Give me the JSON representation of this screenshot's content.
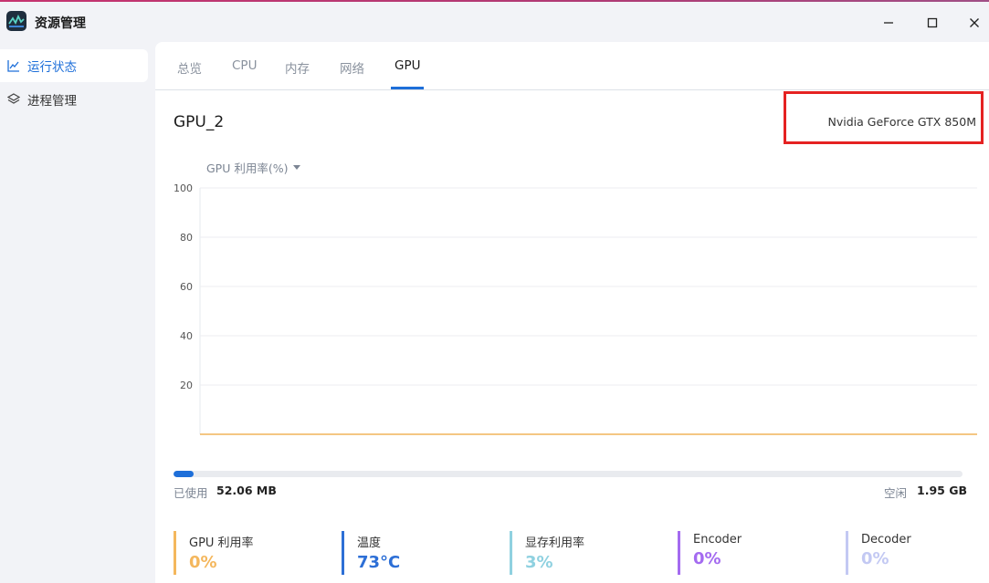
{
  "window": {
    "title": "资源管理",
    "accent": "#1e6fd9"
  },
  "sidebar": {
    "items": [
      {
        "label": "运行状态",
        "icon": "line-chart-icon",
        "active": true
      },
      {
        "label": "进程管理",
        "icon": "layers-icon",
        "active": false
      }
    ]
  },
  "tabs": [
    {
      "label": "总览"
    },
    {
      "label": "CPU"
    },
    {
      "label": "内存"
    },
    {
      "label": "网络"
    },
    {
      "label": "GPU",
      "active": true
    }
  ],
  "gpu": {
    "name": "GPU_2",
    "model": "Nvidia GeForce GTX 850M",
    "metric_select": "GPU 利用率(%)"
  },
  "chart_data": {
    "type": "line",
    "ylim": [
      0,
      100
    ],
    "yticks": [
      "100",
      "80",
      "60",
      "40",
      "20"
    ],
    "grid": true,
    "series": [
      {
        "values": [
          0,
          0,
          0,
          0,
          0,
          0,
          0,
          0,
          0,
          0,
          0,
          0,
          0,
          0,
          0,
          0,
          0,
          0,
          0,
          0,
          0,
          0,
          0,
          0,
          0,
          0,
          0,
          0,
          0,
          0
        ],
        "color": "#f0b35a"
      }
    ]
  },
  "memory": {
    "used_label": "已使用",
    "used_value": "52.06 MB",
    "free_label": "空闲",
    "free_value": "1.95 GB",
    "used_fraction": 0.026
  },
  "stats": [
    {
      "label": "GPU 利用率",
      "value": "0%",
      "color": "#f4b75d"
    },
    {
      "label": "温度",
      "value": "73°C",
      "color": "#2d6fd6"
    },
    {
      "label": "显存利用率",
      "value": "3%",
      "color": "#8fd1e0"
    },
    {
      "label": "Encoder",
      "value": "0%",
      "color": "#a46bf0"
    },
    {
      "label": "Decoder",
      "value": "0%",
      "color": "#c3c9f3"
    }
  ]
}
